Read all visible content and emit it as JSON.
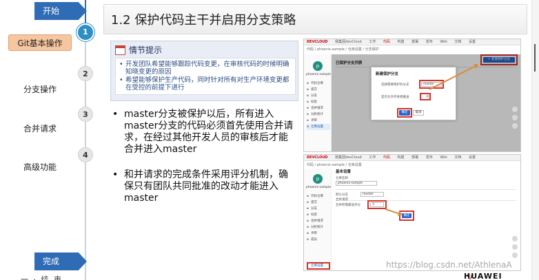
{
  "nav": {
    "start": "开始",
    "done": "完成",
    "items": [
      {
        "num": "1",
        "label": "Git基本操作",
        "active": true
      },
      {
        "num": "2",
        "label": "分支操作",
        "active": false
      },
      {
        "num": "3",
        "label": "合并请求",
        "active": false
      },
      {
        "num": "4",
        "label": "高级功能",
        "active": false
      }
    ],
    "footer_cut": "一 · 结 束"
  },
  "title": "1.2 保护代码主干并启用分支策略",
  "tip": {
    "heading": "情节提示",
    "items": [
      "开发团队希望能够跟踪代码变更，在审核代码的时候明确知晓变更的原因",
      "希望能够保护生产代码，同时针对所有对生产环境变更都在受控的前提下进行"
    ]
  },
  "bullets": [
    "master分支被保护以后，所有进入master分支的代码必须首先使用合并请求，在经过其他开发人员的审核后才能合并进入master",
    "和并请求的完成条件采用评分机制，确保只有团队共同批准的改动才能进入master"
  ],
  "shot1": {
    "brand": "DEVCLOUD",
    "tabs": [
      "我集团devCloud",
      "工作",
      "代码",
      "构建",
      "部署",
      "发布",
      "Wiki",
      "文档",
      "设置"
    ],
    "active_tab": "代码",
    "crumb": "代码 / phoenix-sample / 仓库设置 / 分支保护",
    "project": "phoenix-sample",
    "menu": [
      "代码仓库",
      "提交",
      "分支",
      "标签",
      "合并请求",
      "分析统计",
      "评审",
      "仓库设置"
    ],
    "page_heading": "已保护分支列表",
    "new_button": "+ 新建保护分支",
    "dialog_title": "新建保护分支",
    "dialog_field1": "选择需要保护的分支",
    "dialog_value1": "master",
    "dialog_field2": "是否允许开发者推送",
    "dialog_value2": "否",
    "dialog_confirm": "确定",
    "dialog_cancel": "取消"
  },
  "shot2": {
    "brand": "DEVCLOUD",
    "tabs": [
      "我集团devCloud",
      "工作",
      "代码",
      "构建",
      "部署",
      "发布",
      "Wiki",
      "文档",
      "设置"
    ],
    "active_tab": "代码",
    "crumb": "代码 / phoenix-sample / 仓库设置",
    "project": "phoenix-sample",
    "menu": [
      "代码仓库",
      "提交",
      "分支",
      "标签",
      "合并请求",
      "分析统计",
      "评审",
      "成员",
      "仓库设置"
    ],
    "page_heading": "基本设置",
    "field1_label": "仓库名称",
    "field1_value": "phoenix-sample",
    "field2_label": "默认分支",
    "field2_value": "master",
    "field3_label": "合并请求",
    "field3_sub": "合并所需最低评分",
    "field3_value": "3",
    "confirm": "确定",
    "settings_item": "仓库设置"
  },
  "watermark": "https://blog.csdn.net/AthlenaA",
  "logo_text": "HUAWEI"
}
